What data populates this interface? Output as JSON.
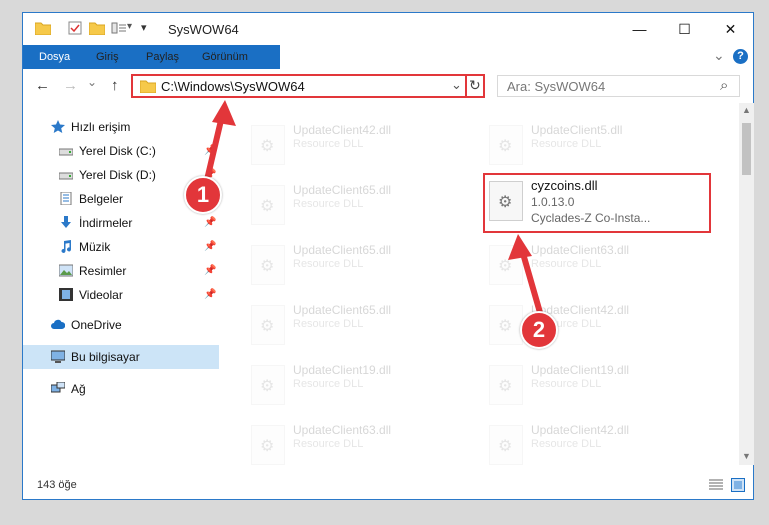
{
  "window": {
    "title": "SysWOW64",
    "minimize": "—",
    "maximize": "☐",
    "close": "✕"
  },
  "ribbon": {
    "tabs": [
      "Dosya",
      "Giriş",
      "Paylaş",
      "Görünüm"
    ],
    "collapse": "⌄",
    "help": "?"
  },
  "nav": {
    "back": "←",
    "forward": "→",
    "dropdown": "⌄",
    "up": "↑",
    "address": "C:\\Windows\\SysWOW64",
    "address_dropdown": "⌄",
    "refresh": "↻",
    "search_placeholder": "Ara: SysWOW64",
    "search_icon": "⌕"
  },
  "sidebar": {
    "items": [
      {
        "label": "Hızlı erişim",
        "icon": "star-icon",
        "pinned": false
      },
      {
        "label": "Yerel Disk (C:)",
        "icon": "drive-icon",
        "pinned": true
      },
      {
        "label": "Yerel Disk (D:)",
        "icon": "drive-icon",
        "pinned": true
      },
      {
        "label": "Belgeler",
        "icon": "document-icon",
        "pinned": true
      },
      {
        "label": "İndirmeler",
        "icon": "download-icon",
        "pinned": true
      },
      {
        "label": "Müzik",
        "icon": "music-icon",
        "pinned": true
      },
      {
        "label": "Resimler",
        "icon": "pictures-icon",
        "pinned": true
      },
      {
        "label": "Videolar",
        "icon": "video-icon",
        "pinned": true
      },
      {
        "label": "OneDrive",
        "icon": "cloud-icon",
        "pinned": false
      },
      {
        "label": "Bu bilgisayar",
        "icon": "computer-icon",
        "pinned": false,
        "selected": true
      },
      {
        "label": "Ağ",
        "icon": "network-icon",
        "pinned": false
      }
    ],
    "pin_glyph": "📌"
  },
  "files": {
    "left_column": [
      {
        "name": "UpdateClient42.dll",
        "type": "Resource DLL"
      },
      {
        "name": "UpdateClient65.dll",
        "type": "Resource DLL"
      },
      {
        "name": "UpdateClient65.dll",
        "type": "Resource DLL"
      },
      {
        "name": "UpdateClient65.dll",
        "type": "Resource DLL"
      },
      {
        "name": "UpdateClient19.dll",
        "type": "Resource DLL"
      },
      {
        "name": "UpdateClient63.dll",
        "type": "Resource DLL"
      }
    ],
    "right_column": [
      {
        "name": "UpdateClient5.dll",
        "type": "Resource DLL"
      },
      {
        "name": "UpdateClient63.dll",
        "type": "Resource DLL"
      },
      {
        "name": "UpdateClient42.dll",
        "type": "Resource DLL"
      },
      {
        "name": "UpdateClient19.dll",
        "type": "Resource DLL"
      },
      {
        "name": "UpdateClient42.dll",
        "type": "Resource DLL"
      }
    ],
    "highlighted": {
      "name": "cyzcoins.dll",
      "version": "1.0.13.0",
      "description": "Cyclades-Z Co-Insta..."
    }
  },
  "status": {
    "count": "143 öğe"
  },
  "annotations": {
    "badge1": "1",
    "badge2": "2",
    "color": "#e2363a"
  }
}
